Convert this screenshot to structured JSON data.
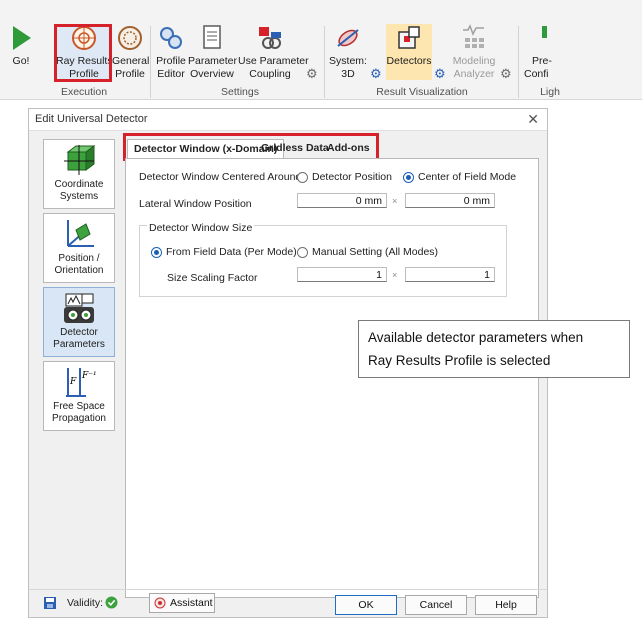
{
  "ribbon": {
    "buttons": [
      {
        "label1": "Go!",
        "label2": ""
      },
      {
        "label1": "Ray Results",
        "label2": "Profile"
      },
      {
        "label1": "General",
        "label2": "Profile"
      },
      {
        "label1": "Profile",
        "label2": "Editor"
      },
      {
        "label1": "Parameter",
        "label2": "Overview"
      },
      {
        "label1": "Use Parameter",
        "label2": "Coupling"
      },
      {
        "label1": "System:",
        "label2": "3D"
      },
      {
        "label1": "Detectors",
        "label2": ""
      },
      {
        "label1": "Modeling",
        "label2": "Analyzer"
      },
      {
        "label1": "Pre-",
        "label2": "Confi"
      }
    ],
    "groups": [
      "Execution",
      "Settings",
      "Result Visualization",
      "Ligh"
    ]
  },
  "dialog": {
    "title": "Edit Universal Detector",
    "nav": [
      {
        "label1": "Coordinate",
        "label2": "Systems"
      },
      {
        "label1": "Position /",
        "label2": "Orientation"
      },
      {
        "label1": "Detector",
        "label2": "Parameters"
      },
      {
        "label1": "Free Space",
        "label2": "Propagation"
      }
    ],
    "tabs": [
      "Detector Window (x-Domain)",
      "Gridless Data",
      "Add-ons"
    ],
    "centered_label": "Detector Window Centered Around",
    "opt_detector_position": "Detector Position",
    "opt_center_field_mode": "Center of Field Mode",
    "lateral_label": "Lateral Window Position",
    "lateral_x": "0 mm",
    "lateral_y": "0 mm",
    "size_group_label": "Detector Window Size",
    "opt_from_field": "From Field Data (Per Mode)",
    "opt_manual": "Manual Setting (All Modes)",
    "scaling_label": "Size Scaling Factor",
    "scale_x": "1",
    "scale_y": "1",
    "times": "×",
    "validity": "Validity:",
    "assistant": "Assistant",
    "ok": "OK",
    "cancel": "Cancel",
    "help": "Help"
  },
  "callout": {
    "line1": "Available detector parameters when",
    "line2": "Ray Results Profile is selected"
  },
  "colors": {
    "highlight": "#d6202a",
    "accent": "#1a5fb4"
  }
}
